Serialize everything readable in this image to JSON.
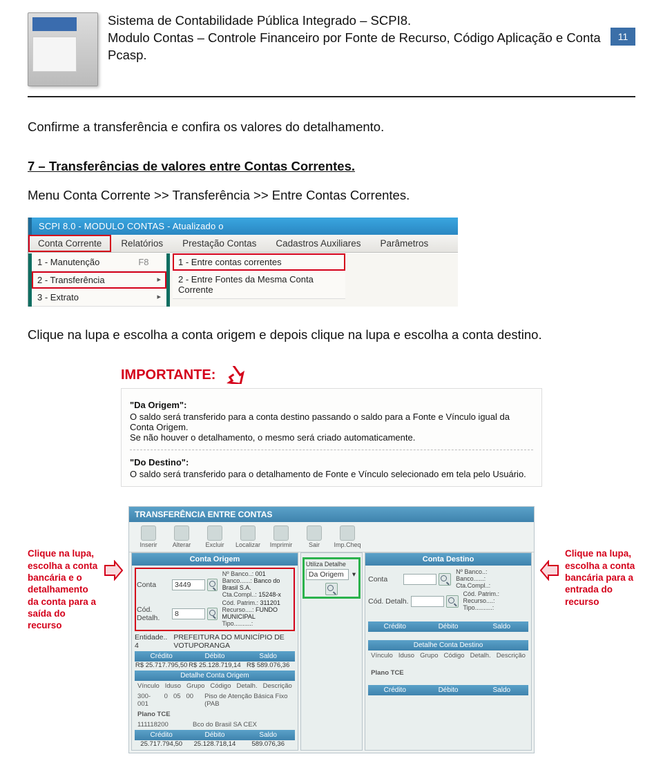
{
  "header": {
    "title": "Sistema de Contabilidade Pública Integrado – SCPI8.",
    "sub": "Modulo Contas – Controle Financeiro por Fonte de Recurso, Código Aplicação e Conta Pcasp.",
    "page": "11"
  },
  "p1": "Confirme a transferência e confira os valores do detalhamento.",
  "section": "7 – Transferências de valores entre Contas Correntes.",
  "p2": "Menu Conta Corrente >> Transferência >> Entre Contas Correntes.",
  "shot1": {
    "title": "SCPI 8.0 - MODULO CONTAS - Atualizado o",
    "menu": [
      "Conta Corrente",
      "Relatórios",
      "Prestação Contas",
      "Cadastros Auxiliares",
      "Parâmetros"
    ],
    "left": {
      "m1": "1 - Manutenção",
      "m1k": "F8",
      "m2": "2 - Transferência",
      "m3": "3 - Extrato"
    },
    "right": {
      "s1": "1 - Entre contas correntes",
      "s2": "2 - Entre Fontes da Mesma Conta Corrente"
    }
  },
  "p3": "Clique na lupa e escolha a conta origem e depois clique na lupa e escolha a conta destino.",
  "imp": {
    "title": "IMPORTANTE:",
    "h1": "\"Da Origem\":",
    "t1": "O saldo será transferido para a conta destino passando o saldo para a Fonte e Vínculo igual da Conta Origem.",
    "t1b": "Se não houver o detalhamento, o mesmo será criado automaticamente.",
    "h2": "\"Do Destino\":",
    "t2": "O saldo será transferido para o detalhamento de Fonte e Vínculo selecionado em tela pelo Usuário."
  },
  "sideL": "Clique na lupa, escolha a conta bancária e o detalhamento da conta para a saída do recurso",
  "sideR": "Clique na lupa, escolha a conta bancária para a entrada do recurso",
  "shot2": {
    "title": "TRANSFERÊNCIA ENTRE CONTAS",
    "tb": [
      "Inserir",
      "Alterar",
      "Excluir",
      "Localizar",
      "Imprimir",
      "Sair",
      "Imp.Cheq"
    ],
    "hO": "Conta Origem",
    "hD": "Conta Destino",
    "lConta": "Conta",
    "lCod": "Cód. Detalh.",
    "vConta": "3449",
    "vCod": "8",
    "nBanco": "Nº Banco..:",
    "nBancoV": "001",
    "banco": "Banco......:",
    "bancoV": "Banco do Brasil S.A.",
    "cta": "Cta.Compl..:",
    "ctaV": "15248-x",
    "patr": "Cód. Patrim.:",
    "patrV": "311201",
    "rec": "Recurso....:",
    "recV": "FUNDO MUNICIPAL",
    "tipo": "Tipo..........:",
    "ent": "Entidade.. 4",
    "entV": "  PREFEITURA DO MUNICÍPIO DE VOTUPORANGA",
    "cred": "Crédito",
    "deb": "Débito",
    "sal": "Saldo",
    "r1": "R$ 25.717.795,50",
    "r2": "R$ 25.128.719,14",
    "r3": "R$ 589.076,36",
    "detO": "Detalhe Conta Origem",
    "detD": "Detalhe Conta Destino",
    "dH": [
      "Vínculo",
      "Iduso",
      "Grupo",
      "Código",
      "Detalh.",
      "Descrição"
    ],
    "dR": [
      "300-001",
      "0",
      "05",
      "00",
      "",
      "Piso de Atenção Básica Fixo (PAB"
    ],
    "plano": "Plano TCE",
    "planoV": "111118200",
    "planoD": "Bco do Brasil SA CEX",
    "c1": "25.717.794,50",
    "c2": "25.128.718,14",
    "c3": "589.076,36",
    "midH": "Utiliza Detalhe",
    "mid": "Da Origem"
  }
}
